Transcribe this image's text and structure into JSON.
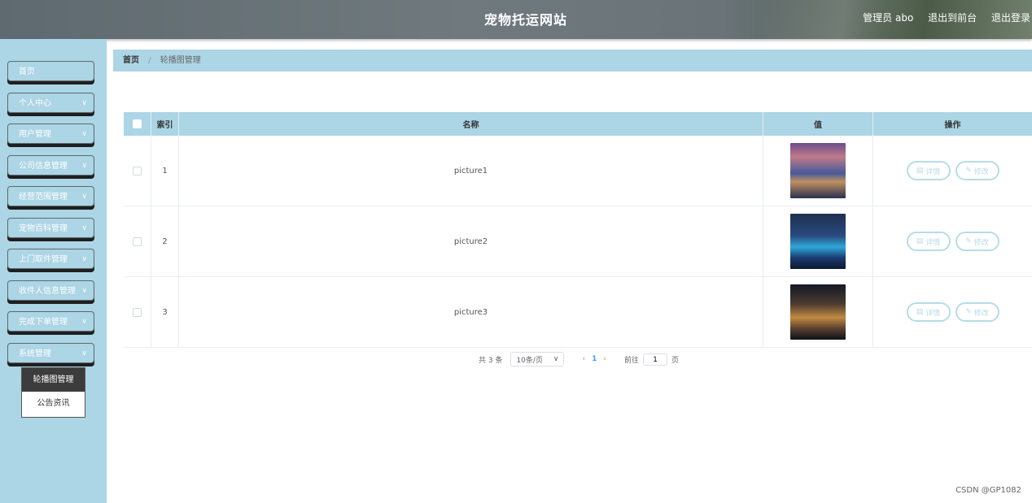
{
  "header": {
    "title": "宠物托运网站",
    "admin_label": "管理员 abo",
    "to_front": "退出到前台",
    "logout": "退出登录"
  },
  "sidebar": {
    "items": [
      {
        "label": "首页",
        "has_chevron": false
      },
      {
        "label": "个人中心",
        "has_chevron": true
      },
      {
        "label": "用户管理",
        "has_chevron": true
      },
      {
        "label": "公司信息管理",
        "has_chevron": true
      },
      {
        "label": "经营范围管理",
        "has_chevron": true
      },
      {
        "label": "宠物百科管理",
        "has_chevron": true
      },
      {
        "label": "上门取件管理",
        "has_chevron": true
      },
      {
        "label": "收件人信息管理",
        "has_chevron": true
      },
      {
        "label": "完成下单管理",
        "has_chevron": true
      },
      {
        "label": "系统管理",
        "has_chevron": true
      }
    ],
    "submenu": [
      {
        "label": "轮播图管理",
        "active": true
      },
      {
        "label": "公告资讯",
        "active": false
      }
    ]
  },
  "breadcrumb": {
    "home": "首页",
    "separator": "/",
    "current": "轮播图管理"
  },
  "table": {
    "headers": {
      "index": "索引",
      "name": "名称",
      "value": "值",
      "ops": "操作"
    },
    "rows": [
      {
        "index": "1",
        "name": "picture1",
        "detail": "详情",
        "edit": "修改"
      },
      {
        "index": "2",
        "name": "picture2",
        "detail": "详情",
        "edit": "修改"
      },
      {
        "index": "3",
        "name": "picture3",
        "detail": "详情",
        "edit": "修改"
      }
    ]
  },
  "pagination": {
    "total": "共 3 条",
    "page_size": "10条/页",
    "current_page": "1",
    "goto_label": "前往",
    "goto_value": "1",
    "page_unit": "页"
  },
  "watermark": "CSDN @GP1082",
  "colors": {
    "sidebar_bg": "#acd5e5",
    "header_bg": "#6f797e",
    "button_border": "#b8dbe8"
  }
}
